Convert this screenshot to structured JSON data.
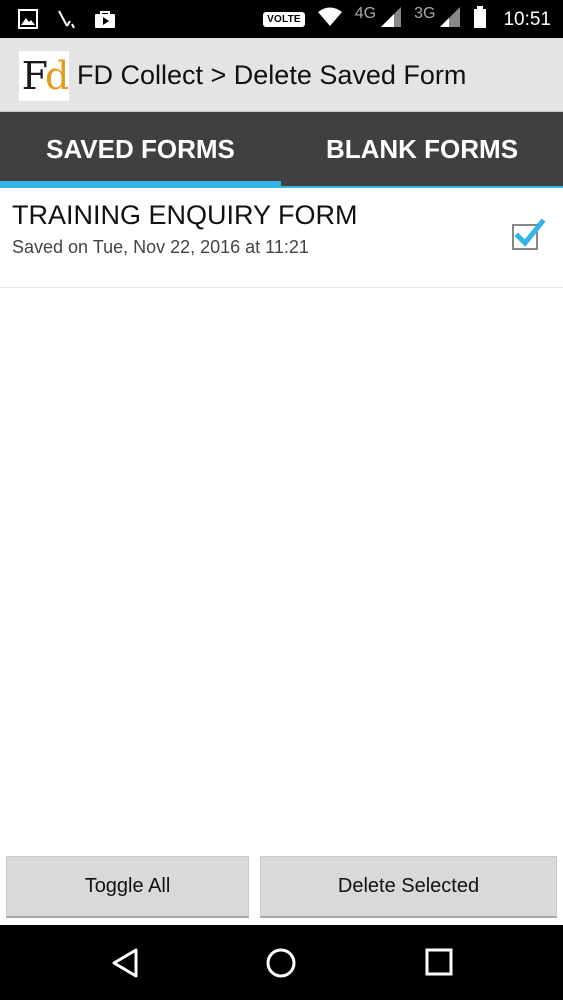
{
  "status_bar": {
    "icons_left": [
      "gallery-icon",
      "missed-call-icon",
      "play-store-icon"
    ],
    "volte": "VOLTE",
    "network_1": "4G",
    "network_2": "3G",
    "time": "10:51"
  },
  "app_bar": {
    "logo_text_f": "F",
    "logo_text_d": "d",
    "title": "FD Collect > Delete Saved Form"
  },
  "tabs": [
    {
      "label": "SAVED FORMS",
      "selected": true
    },
    {
      "label": "BLANK FORMS",
      "selected": false
    }
  ],
  "list": {
    "items": [
      {
        "title": "TRAINING ENQUIRY FORM",
        "subtitle": "Saved on Tue, Nov 22, 2016 at 11:21",
        "checked": true
      }
    ]
  },
  "buttons": {
    "toggle_all": "Toggle All",
    "delete_selected": "Delete Selected"
  },
  "colors": {
    "accent": "#33b5e5",
    "tab_bar": "#404040",
    "app_bar": "#e4e4e4",
    "logo_d": "#e49b1a"
  }
}
